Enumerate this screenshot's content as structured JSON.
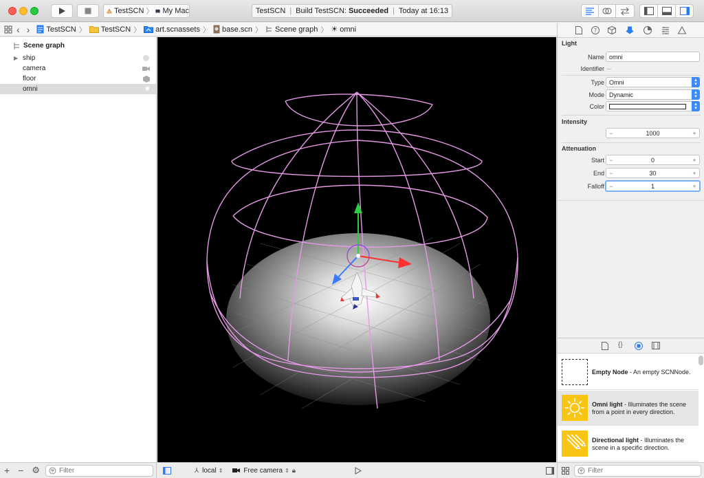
{
  "toolbar": {
    "scheme_name": "TestSCN",
    "device_name": "My Mac",
    "status_project": "TestSCN",
    "status_build_prefix": "Build TestSCN:",
    "status_build_result": "Succeeded",
    "status_time": "Today at 16:13"
  },
  "jumpbar": {
    "crumbs": [
      "TestSCN",
      "TestSCN",
      "art.scnassets",
      "base.scn",
      "Scene graph",
      "omni"
    ]
  },
  "scene_graph": {
    "title": "Scene graph",
    "nodes": [
      {
        "label": "ship",
        "icon": "geometry-icon"
      },
      {
        "label": "camera",
        "icon": "camera-icon"
      },
      {
        "label": "floor",
        "icon": "floor-icon"
      },
      {
        "label": "omni",
        "icon": "light-icon"
      }
    ],
    "selected_index": 3,
    "filter_placeholder": "Filter"
  },
  "viewport_bar": {
    "coordinate_space": "local",
    "camera": "Free camera"
  },
  "inspector": {
    "section_light": "Light",
    "name_label": "Name",
    "name_value": "omni",
    "identifier_label": "Identifier",
    "identifier_value": "--",
    "type_label": "Type",
    "type_value": "Omni",
    "mode_label": "Mode",
    "mode_value": "Dynamic",
    "color_label": "Color",
    "color_value": "#ffffff",
    "section_intensity": "Intensity",
    "intensity_value": "1000",
    "section_attenuation": "Attenuation",
    "start_label": "Start",
    "start_value": "0",
    "end_label": "End",
    "end_value": "30",
    "falloff_label": "Falloff",
    "falloff_value": "1",
    "minus": "−",
    "plus": "+"
  },
  "library": {
    "items": [
      {
        "name": "Empty Node",
        "desc": " - An empty SCNNode."
      },
      {
        "name": "Omni light",
        "desc": " - Illuminates the scene from a point in every direction."
      },
      {
        "name": "Directional light",
        "desc": " - Illuminates the scene in a specific direction."
      }
    ],
    "filter_placeholder": "Filter"
  },
  "colors": {
    "accent": "#3b8cf6",
    "light_icon_bg": "#f9c515",
    "wireframe": "#e59ae6"
  }
}
